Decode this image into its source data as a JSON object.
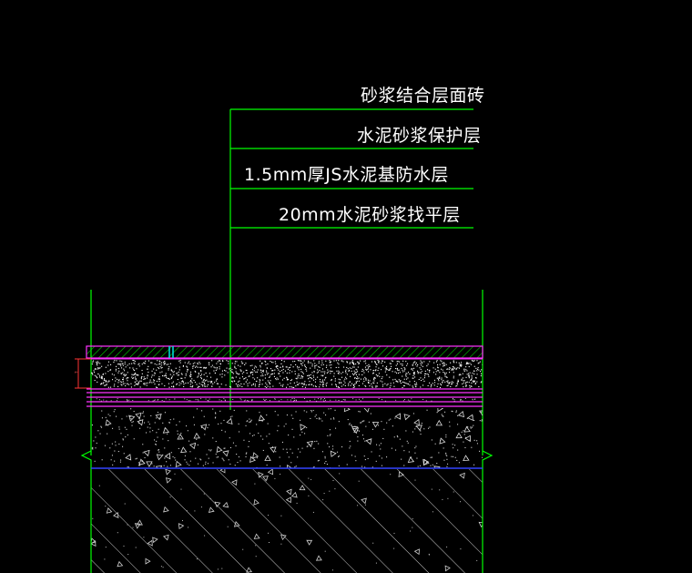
{
  "colors": {
    "background": "#000000",
    "leader": "#00ff00",
    "layer_line": "#ff33ff",
    "base_line": "#3344ff",
    "text": "#ffffff",
    "accent": "#00e5e5"
  },
  "labels": [
    {
      "text": "砂浆结合层面砖"
    },
    {
      "text": "水泥砂浆保护层"
    },
    {
      "text": "1.5mm厚JS水泥基防水层"
    },
    {
      "text": "20mm水泥砂浆找平层"
    }
  ],
  "dimension": {
    "text": "?"
  }
}
